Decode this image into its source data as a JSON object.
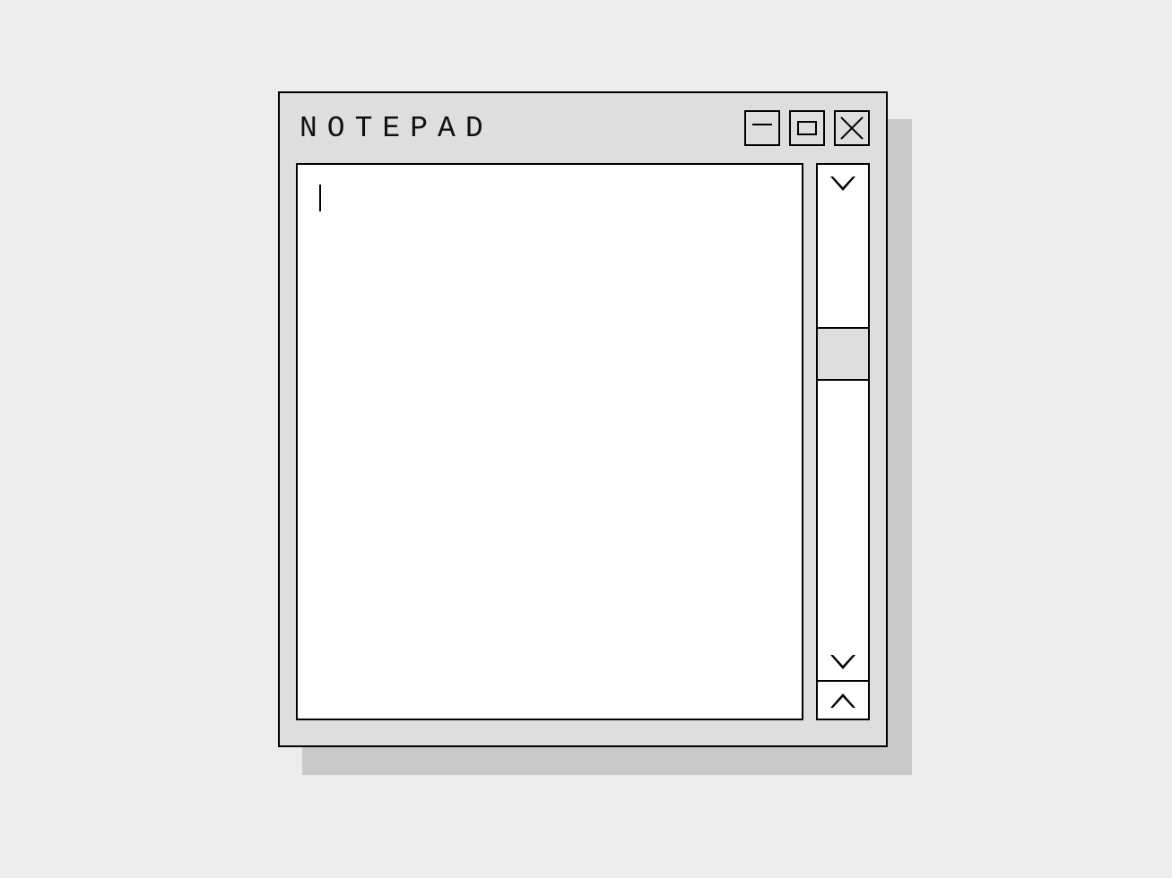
{
  "window": {
    "title": "NOTEPAD",
    "content": ""
  }
}
